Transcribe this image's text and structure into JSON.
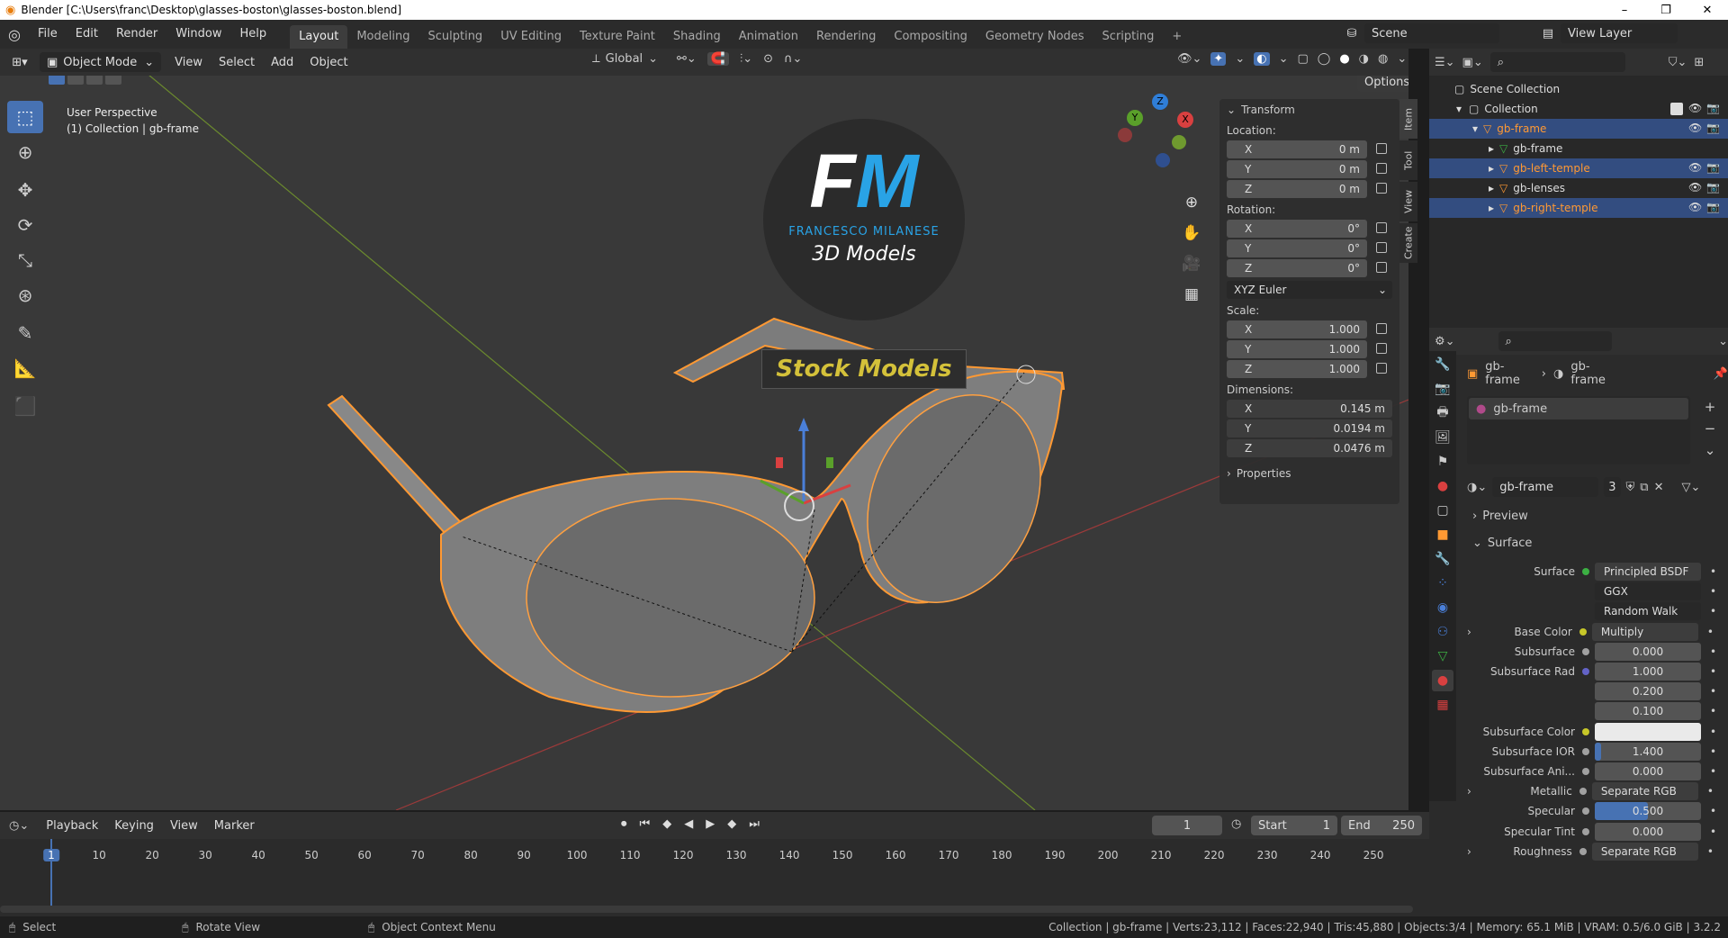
{
  "window": {
    "title": "Blender [C:\\Users\\franc\\Desktop\\glasses-boston\\glasses-boston.blend]",
    "minimize": "–",
    "maximize": "❐",
    "close": "✕"
  },
  "menu": {
    "items": [
      "File",
      "Edit",
      "Render",
      "Window",
      "Help"
    ]
  },
  "workspaces": {
    "tabs": [
      "Layout",
      "Modeling",
      "Sculpting",
      "UV Editing",
      "Texture Paint",
      "Shading",
      "Animation",
      "Rendering",
      "Compositing",
      "Geometry Nodes",
      "Scripting"
    ],
    "active": "Layout",
    "add": "+"
  },
  "scene": {
    "name": "Scene",
    "view_layer": "View Layer"
  },
  "viewport_header": {
    "mode": "Object Mode",
    "menus": [
      "View",
      "Select",
      "Add",
      "Object"
    ],
    "orientation": "Global",
    "options": "Options"
  },
  "viewport": {
    "perspective": "User Perspective",
    "context": "(1) Collection | gb-frame"
  },
  "watermark": {
    "initials": "FM",
    "name": "FRANCESCO MILANESE",
    "subtitle": "3D Models",
    "banner": "Stock Models"
  },
  "gizmo": {
    "x": "X",
    "y": "Y",
    "z": "Z"
  },
  "sidebar_tabs": [
    "Item",
    "Tool",
    "View",
    "Create"
  ],
  "transform": {
    "title": "Transform",
    "location_label": "Location:",
    "location": [
      {
        "axis": "X",
        "value": "0 m"
      },
      {
        "axis": "Y",
        "value": "0 m"
      },
      {
        "axis": "Z",
        "value": "0 m"
      }
    ],
    "rotation_label": "Rotation:",
    "rotation": [
      {
        "axis": "X",
        "value": "0°"
      },
      {
        "axis": "Y",
        "value": "0°"
      },
      {
        "axis": "Z",
        "value": "0°"
      }
    ],
    "rotation_mode": "XYZ Euler",
    "scale_label": "Scale:",
    "scale": [
      {
        "axis": "X",
        "value": "1.000"
      },
      {
        "axis": "Y",
        "value": "1.000"
      },
      {
        "axis": "Z",
        "value": "1.000"
      }
    ],
    "dimensions_label": "Dimensions:",
    "dimensions": [
      {
        "axis": "X",
        "value": "0.145 m"
      },
      {
        "axis": "Y",
        "value": "0.0194 m"
      },
      {
        "axis": "Z",
        "value": "0.0476 m"
      }
    ],
    "properties": "Properties"
  },
  "outliner": {
    "scene_collection": "Scene Collection",
    "collection": "Collection",
    "items": [
      {
        "name": "gb-frame",
        "level": 1,
        "selected": true,
        "color": "#ff9933"
      },
      {
        "name": "gb-frame",
        "level": 2,
        "selected": false,
        "color": "#dddddd"
      },
      {
        "name": "gb-left-temple",
        "level": 2,
        "selected": true,
        "color": "#ff9933"
      },
      {
        "name": "gb-lenses",
        "level": 2,
        "selected": false,
        "color": "#dddddd"
      },
      {
        "name": "gb-right-temple",
        "level": 2,
        "selected": true,
        "color": "#ff9933"
      }
    ]
  },
  "properties": {
    "breadcrumb": [
      "gb-frame",
      "gb-frame"
    ],
    "material_slot": "gb-frame",
    "material_name": "gb-frame",
    "users": "3",
    "sections": {
      "preview": "Preview",
      "surface": "Surface"
    },
    "rows": [
      {
        "label": "Surface",
        "value": "Principled BSDF",
        "dot": "#3cb043",
        "type": "node"
      },
      {
        "label": "",
        "value": "GGX",
        "dot": "",
        "type": "dropdown"
      },
      {
        "label": "",
        "value": "Random Walk",
        "dot": "",
        "type": "dropdown"
      },
      {
        "label": "Base Color",
        "value": "Multiply",
        "dot": "#c7c729",
        "type": "node",
        "expand": true
      },
      {
        "label": "Subsurface",
        "value": "0.000",
        "dot": "#a1a1a1",
        "type": "num"
      },
      {
        "label": "Subsurface Rad",
        "value": "1.000",
        "dot": "#6363c7",
        "type": "num"
      },
      {
        "label": "",
        "value": "0.200",
        "dot": "",
        "type": "num"
      },
      {
        "label": "",
        "value": "0.100",
        "dot": "",
        "type": "num"
      },
      {
        "label": "Subsurface Color",
        "value": "",
        "dot": "#c7c729",
        "type": "color"
      },
      {
        "label": "Subsurface IOR",
        "value": "1.400",
        "dot": "#a1a1a1",
        "type": "slider",
        "fill": 0.06
      },
      {
        "label": "Subsurface Ani...",
        "value": "0.000",
        "dot": "#a1a1a1",
        "type": "num"
      },
      {
        "label": "Metallic",
        "value": "Separate RGB",
        "dot": "#a1a1a1",
        "type": "node",
        "expand": true
      },
      {
        "label": "Specular",
        "value": "0.500",
        "dot": "#a1a1a1",
        "type": "slider",
        "fill": 0.5
      },
      {
        "label": "Specular Tint",
        "value": "0.000",
        "dot": "#a1a1a1",
        "type": "num"
      },
      {
        "label": "Roughness",
        "value": "Separate RGB",
        "dot": "#a1a1a1",
        "type": "node",
        "expand": true
      }
    ]
  },
  "timeline": {
    "menus": [
      "Playback",
      "Keying",
      "View",
      "Marker"
    ],
    "current_frame": "1",
    "start_label": "Start",
    "start": "1",
    "end_label": "End",
    "end": "250",
    "ruler": [
      "1",
      "10",
      "20",
      "30",
      "40",
      "50",
      "60",
      "70",
      "80",
      "90",
      "100",
      "110",
      "120",
      "130",
      "140",
      "150",
      "160",
      "170",
      "180",
      "190",
      "200",
      "210",
      "220",
      "230",
      "240",
      "250"
    ]
  },
  "status": {
    "hints": [
      "Select",
      "Rotate View",
      "Object Context Menu"
    ],
    "stats": "Collection | gb-frame | Verts:23,112 | Faces:22,940 | Tris:45,880 | Objects:3/4 | Memory: 65.1 MiB | VRAM: 0.5/6.0 GiB | 3.2.2"
  }
}
